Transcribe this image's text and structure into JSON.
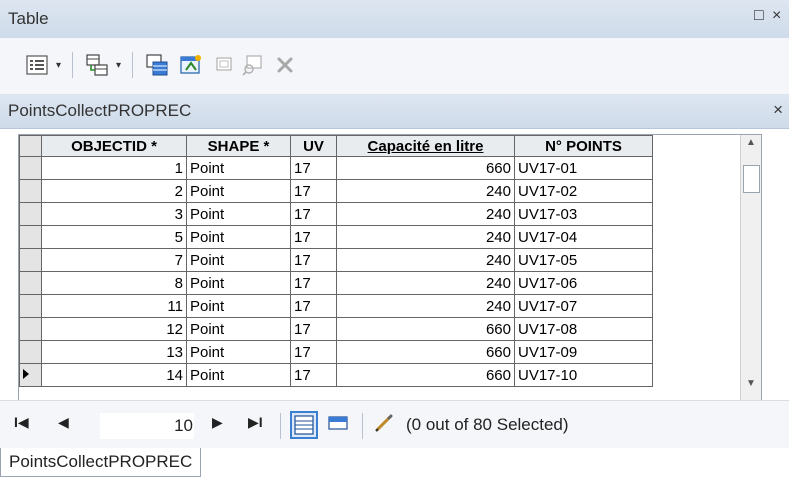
{
  "window": {
    "title": "Table",
    "restore_glyph": "□",
    "close_glyph": "×"
  },
  "toolbar": {
    "buttons": [
      {
        "name": "table-options-icon",
        "has_dropdown": true
      },
      {
        "name": "related-tables-icon",
        "has_dropdown": true
      },
      {
        "name": "select-by-attributes-icon"
      },
      {
        "name": "switch-selection-icon"
      },
      {
        "name": "clear-selection-icon"
      },
      {
        "name": "zoom-to-selected-icon"
      },
      {
        "name": "delete-selected-icon"
      }
    ],
    "dropdown_glyph": "▾"
  },
  "table_tab": {
    "name": "PointsCollectPROPREC",
    "close_glyph": "×"
  },
  "grid": {
    "columns": [
      "OBJECTID *",
      "SHAPE *",
      "UV",
      "Capacité en litre",
      "N° POINTS"
    ],
    "rows": [
      [
        "1",
        "Point",
        "17",
        "660",
        "UV17-01"
      ],
      [
        "2",
        "Point",
        "17",
        "240",
        "UV17-02"
      ],
      [
        "3",
        "Point",
        "17",
        "240",
        "UV17-03"
      ],
      [
        "5",
        "Point",
        "17",
        "240",
        "UV17-04"
      ],
      [
        "7",
        "Point",
        "17",
        "240",
        "UV17-05"
      ],
      [
        "8",
        "Point",
        "17",
        "240",
        "UV17-06"
      ],
      [
        "11",
        "Point",
        "17",
        "240",
        "UV17-07"
      ],
      [
        "12",
        "Point",
        "17",
        "660",
        "UV17-08"
      ],
      [
        "13",
        "Point",
        "17",
        "660",
        "UV17-09"
      ],
      [
        "14",
        "Point",
        "17",
        "660",
        "UV17-10"
      ]
    ],
    "current_row_index": 9
  },
  "navigation": {
    "first_glyph": "I◀",
    "prev_glyph": "◀",
    "record": "10",
    "next_glyph": "▶",
    "last_glyph": "▶I",
    "selection_status": "(0 out of 80 Selected)"
  },
  "bottom_tab": {
    "label": "PointsCollectPROPREC"
  }
}
